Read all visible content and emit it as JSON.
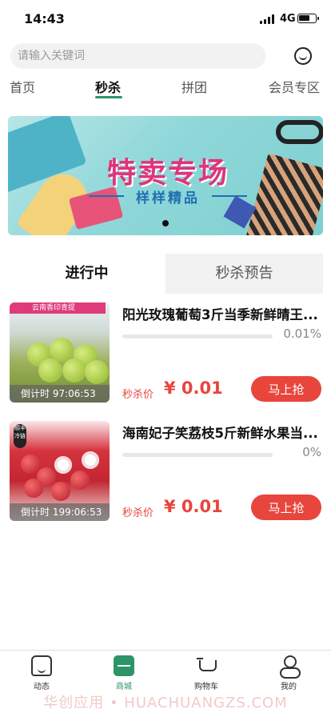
{
  "status_bar": {
    "time": "14:43",
    "network": "4G",
    "battery_level": 0.7
  },
  "search": {
    "placeholder": "请输入关键词"
  },
  "top_tabs": [
    {
      "label": "首页",
      "active": false
    },
    {
      "label": "秒杀",
      "active": true
    },
    {
      "label": "拼团",
      "active": false
    },
    {
      "label": "会员专区",
      "active": false
    }
  ],
  "banner": {
    "title": "特卖专场",
    "subtitle": "样样精品"
  },
  "segment_tabs": [
    {
      "label": "进行中",
      "active": true
    },
    {
      "label": "秒杀预告",
      "active": false
    }
  ],
  "products": [
    {
      "title": "阳光玫瑰葡萄3斤当季新鲜晴王...",
      "thumb_tag": "云南香印青提",
      "percent_text": "0.01%",
      "progress_fraction": 0.0001,
      "countdown": "倒计时 97:06:53",
      "price_label": "秒杀价",
      "price": "¥ 0.01",
      "button_label": "马上抢"
    },
    {
      "title": "海南妃子笑荔枝5斤新鲜水果当...",
      "thumb_tag": "顺丰冷链",
      "percent_text": "0%",
      "progress_fraction": 0,
      "countdown": "倒计时 199:06:53",
      "price_label": "秒杀价",
      "price": "¥ 0.01",
      "button_label": "马上抢"
    }
  ],
  "tabbar": [
    {
      "label": "动态",
      "icon": "home-icon",
      "active": false
    },
    {
      "label": "商城",
      "icon": "mall-icon",
      "active": true
    },
    {
      "label": "购物车",
      "icon": "cart-icon",
      "active": false
    },
    {
      "label": "我的",
      "icon": "profile-icon",
      "active": false
    }
  ],
  "watermark": "华创应用 • HUACHUANGZS.COM",
  "colors": {
    "accent_green": "#2d9468",
    "price_red": "#e8453c"
  }
}
